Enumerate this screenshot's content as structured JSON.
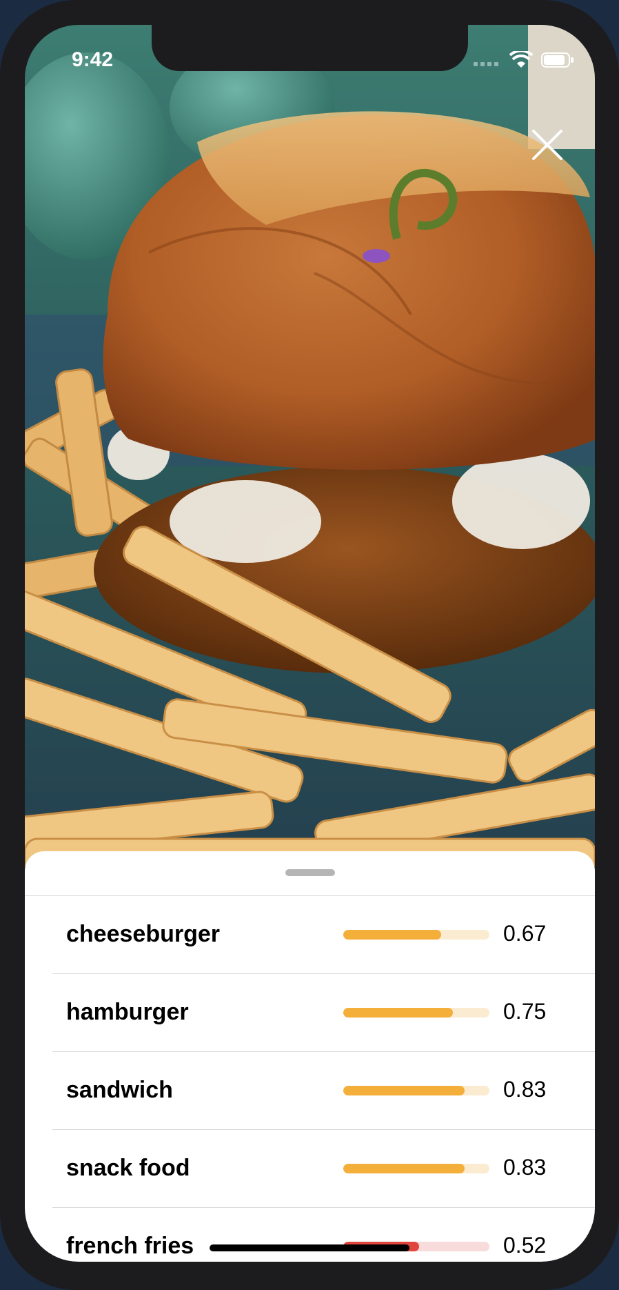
{
  "status_bar": {
    "time": "9:42"
  },
  "close_icon": "close-icon",
  "results": [
    {
      "label": "cheeseburger",
      "score": 0.67,
      "score_text": "0.67",
      "color": "#f4ae3a"
    },
    {
      "label": "hamburger",
      "score": 0.75,
      "score_text": "0.75",
      "color": "#f4ae3a"
    },
    {
      "label": "sandwich",
      "score": 0.83,
      "score_text": "0.83",
      "color": "#f4ae3a"
    },
    {
      "label": "snack food",
      "score": 0.83,
      "score_text": "0.83",
      "color": "#f4ae3a"
    },
    {
      "label": "french fries",
      "score": 0.52,
      "score_text": "0.52",
      "color": "#e0463d"
    }
  ]
}
